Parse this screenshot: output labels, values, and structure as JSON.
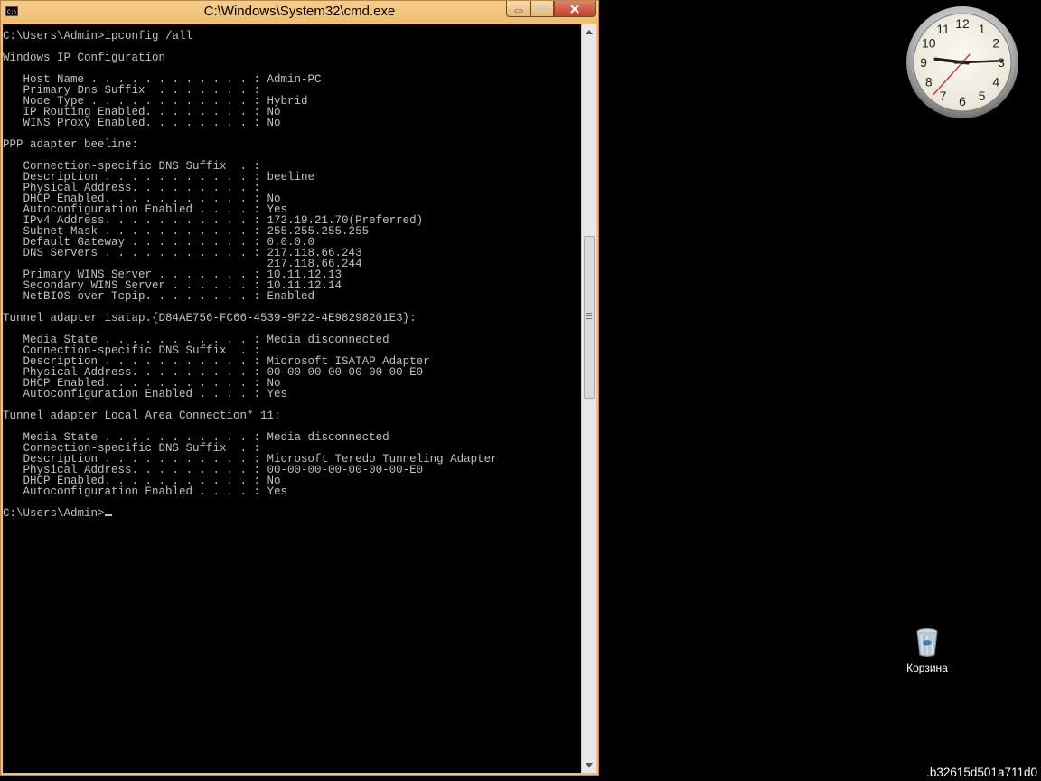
{
  "window": {
    "title": "C:\\Windows\\System32\\cmd.exe",
    "icon_name": "cmd-app-icon",
    "accent_color": "#f0c27a"
  },
  "console": {
    "lines": [
      "C:\\Users\\Admin>ipconfig /all",
      "",
      "Windows IP Configuration",
      "",
      "   Host Name . . . . . . . . . . . . : Admin-PC",
      "   Primary Dns Suffix  . . . . . . . :",
      "   Node Type . . . . . . . . . . . . : Hybrid",
      "   IP Routing Enabled. . . . . . . . : No",
      "   WINS Proxy Enabled. . . . . . . . : No",
      "",
      "PPP adapter beeline:",
      "",
      "   Connection-specific DNS Suffix  . :",
      "   Description . . . . . . . . . . . : beeline",
      "   Physical Address. . . . . . . . . :",
      "   DHCP Enabled. . . . . . . . . . . : No",
      "   Autoconfiguration Enabled . . . . : Yes",
      "   IPv4 Address. . . . . . . . . . . : 172.19.21.70(Preferred)",
      "   Subnet Mask . . . . . . . . . . . : 255.255.255.255",
      "   Default Gateway . . . . . . . . . : 0.0.0.0",
      "   DNS Servers . . . . . . . . . . . : 217.118.66.243",
      "                                       217.118.66.244",
      "   Primary WINS Server . . . . . . . : 10.11.12.13",
      "   Secondary WINS Server . . . . . . : 10.11.12.14",
      "   NetBIOS over Tcpip. . . . . . . . : Enabled",
      "",
      "Tunnel adapter isatap.{D84AE756-FC66-4539-9F22-4E98298201E3}:",
      "",
      "   Media State . . . . . . . . . . . : Media disconnected",
      "   Connection-specific DNS Suffix  . :",
      "   Description . . . . . . . . . . . : Microsoft ISATAP Adapter",
      "   Physical Address. . . . . . . . . : 00-00-00-00-00-00-00-E0",
      "   DHCP Enabled. . . . . . . . . . . : No",
      "   Autoconfiguration Enabled . . . . : Yes",
      "",
      "Tunnel adapter Local Area Connection* 11:",
      "",
      "   Media State . . . . . . . . . . . : Media disconnected",
      "   Connection-specific DNS Suffix  . :",
      "   Description . . . . . . . . . . . : Microsoft Teredo Tunneling Adapter",
      "   Physical Address. . . . . . . . . : 00-00-00-00-00-00-00-E0",
      "   DHCP Enabled. . . . . . . . . . . : No",
      "   Autoconfiguration Enabled . . . . : Yes",
      ""
    ],
    "prompt": "C:\\Users\\Admin>"
  },
  "clock": {
    "numbers": [
      "12",
      "1",
      "2",
      "3",
      "4",
      "5",
      "6",
      "7",
      "8",
      "9",
      "10",
      "11"
    ],
    "time": {
      "hour": 9,
      "minute": 14,
      "second": 37
    }
  },
  "desktop": {
    "recycle_bin_label": "Корзина",
    "build_text": ".b32615d501a711d0"
  }
}
